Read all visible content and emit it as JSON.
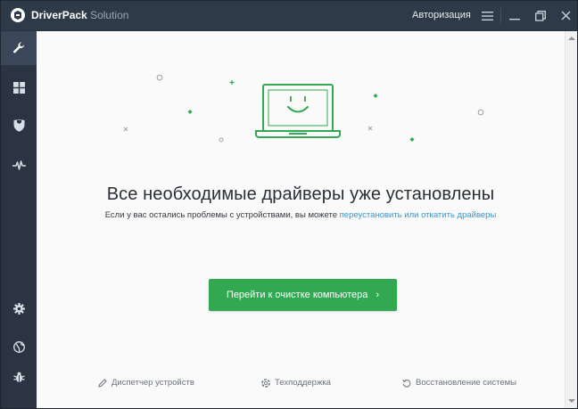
{
  "titlebar": {
    "brand_bold": "DriverPack",
    "brand_light": "Solution",
    "auth_label": "Авторизация",
    "menu_icon": "hamburger-icon",
    "minimize_icon": "minimize-icon",
    "restore_icon": "restore-icon",
    "close_icon": "close-icon"
  },
  "sidebar": {
    "items": [
      {
        "name": "wrench-icon",
        "active": true
      },
      {
        "name": "grid-icon",
        "active": false
      },
      {
        "name": "shield-icon",
        "active": false
      },
      {
        "name": "pulse-icon",
        "active": false
      },
      {
        "name": "gear-icon",
        "active": false
      },
      {
        "name": "globe-icon",
        "active": false
      },
      {
        "name": "bug-icon",
        "active": false
      }
    ]
  },
  "main": {
    "headline": "Все необходимые драйверы уже установлены",
    "subline_prefix": "Если у вас остались проблемы с устройствами, вы можете ",
    "subline_link": "переустановить или откатить драйверы",
    "primary_button_label": "Перейти к очистке компьютера",
    "primary_button_chevron": "›"
  },
  "footer": {
    "device_manager": "Диспетчер устройств",
    "support": "Техподдержка",
    "system_restore": "Восстановление системы"
  },
  "colors": {
    "accent_green": "#32a852",
    "link_blue": "#3a95c9",
    "sidebar_bg": "#2b3442"
  }
}
